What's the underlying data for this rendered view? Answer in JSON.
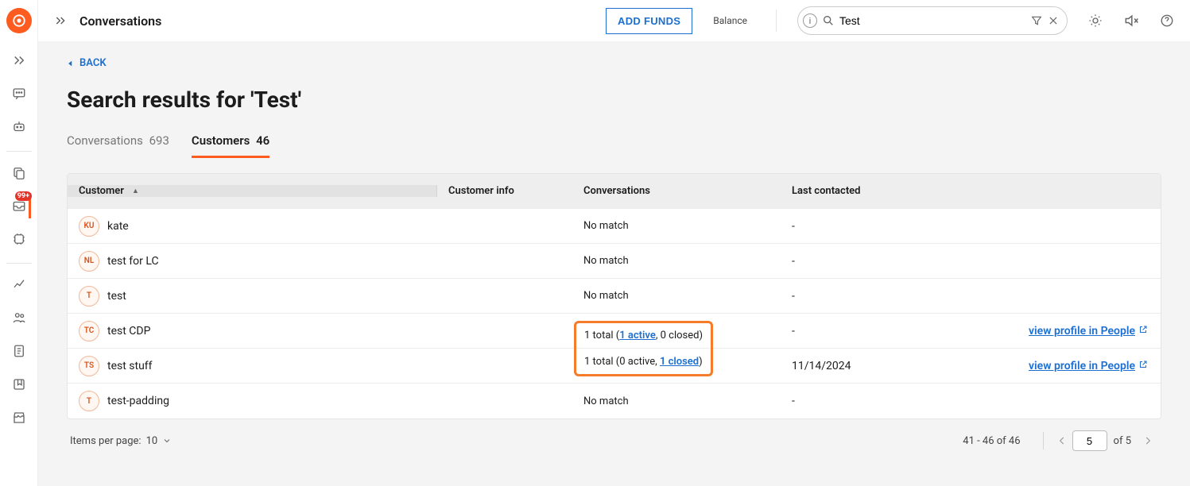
{
  "topbar": {
    "title": "Conversations",
    "add_funds": "ADD FUNDS",
    "balance_label": "Balance"
  },
  "search": {
    "value": "Test"
  },
  "content": {
    "back": "BACK",
    "heading": "Search results for 'Test'"
  },
  "tabs": {
    "conversations": {
      "label": "Conversations",
      "count": "693"
    },
    "customers": {
      "label": "Customers",
      "count": "46"
    }
  },
  "table": {
    "columns": {
      "customer": "Customer",
      "info": "Customer info",
      "conversations": "Conversations",
      "last": "Last contacted"
    },
    "rows": [
      {
        "initials": "KU",
        "name": "kate",
        "conv_text": "No match",
        "last": "-",
        "profile_link": ""
      },
      {
        "initials": "NL",
        "name": "test for LC",
        "conv_text": "No match",
        "last": "-",
        "profile_link": ""
      },
      {
        "initials": "T",
        "name": "test",
        "conv_text": "No match",
        "last": "-",
        "profile_link": ""
      },
      {
        "initials": "TC",
        "name": "test CDP",
        "conv_total": "1 total (",
        "conv_link": "1 active",
        "conv_rest": ", 0 closed)",
        "last": "-",
        "profile_link": "view profile in People"
      },
      {
        "initials": "TS",
        "name": "test stuff",
        "conv_total": "1 total (0 active, ",
        "conv_link": "1 closed",
        "conv_rest": ")",
        "last": "11/14/2024",
        "profile_link": "view profile in People"
      },
      {
        "initials": "T",
        "name": "test-padding",
        "conv_text": "No match",
        "last": "-",
        "profile_link": ""
      }
    ]
  },
  "pagination": {
    "items_per_page_label": "Items per page:",
    "items_per_page_value": "10",
    "range": "41 - 46 of 46",
    "page_input": "5",
    "page_total": "of 5"
  },
  "nav": {
    "badge": "99+"
  }
}
